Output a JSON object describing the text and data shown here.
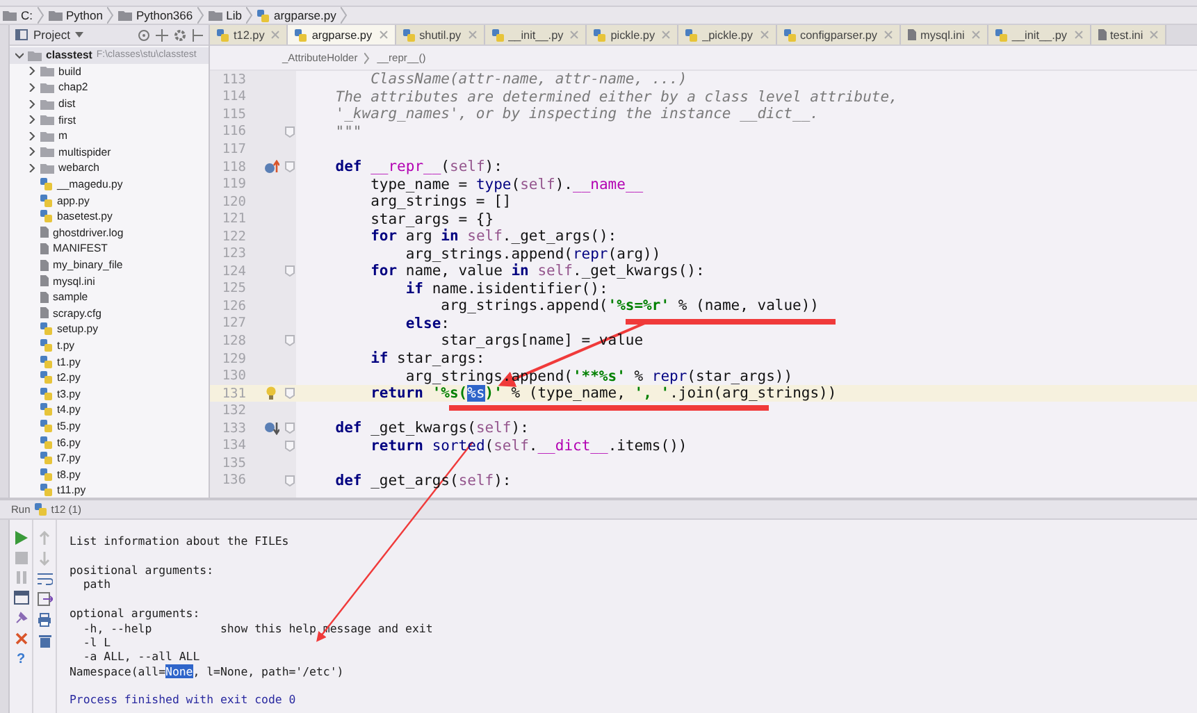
{
  "breadcrumbs": [
    {
      "label": "C:",
      "kind": "drive"
    },
    {
      "label": "Python",
      "kind": "folder"
    },
    {
      "label": "Python366",
      "kind": "folder"
    },
    {
      "label": "Lib",
      "kind": "folder"
    },
    {
      "label": "argparse.py",
      "kind": "python"
    }
  ],
  "project_panel": {
    "title": "Project",
    "tree": [
      {
        "label": "classtest",
        "path": "F:\\classes\\stu\\classtest",
        "kind": "folder",
        "expanded": true,
        "children": [
          {
            "label": "build",
            "kind": "folder",
            "expanded": false
          },
          {
            "label": "chap2",
            "kind": "folder",
            "expanded": false
          },
          {
            "label": "dist",
            "kind": "folder",
            "expanded": false
          },
          {
            "label": "first",
            "kind": "folder",
            "expanded": false
          },
          {
            "label": "m",
            "kind": "folder",
            "expanded": false
          },
          {
            "label": "multispider",
            "kind": "folder",
            "expanded": false
          },
          {
            "label": "webarch",
            "kind": "folder",
            "expanded": false
          },
          {
            "label": "__magedu.py",
            "kind": "python"
          },
          {
            "label": "app.py",
            "kind": "python"
          },
          {
            "label": "basetest.py",
            "kind": "python"
          },
          {
            "label": "ghostdriver.log",
            "kind": "file"
          },
          {
            "label": "MANIFEST",
            "kind": "file"
          },
          {
            "label": "my_binary_file",
            "kind": "file"
          },
          {
            "label": "mysql.ini",
            "kind": "file"
          },
          {
            "label": "sample",
            "kind": "file"
          },
          {
            "label": "scrapy.cfg",
            "kind": "file"
          },
          {
            "label": "setup.py",
            "kind": "python"
          },
          {
            "label": "t.py",
            "kind": "python"
          },
          {
            "label": "t1.py",
            "kind": "python"
          },
          {
            "label": "t2.py",
            "kind": "python"
          },
          {
            "label": "t3.py",
            "kind": "python"
          },
          {
            "label": "t4.py",
            "kind": "python"
          },
          {
            "label": "t5.py",
            "kind": "python"
          },
          {
            "label": "t6.py",
            "kind": "python"
          },
          {
            "label": "t7.py",
            "kind": "python"
          },
          {
            "label": "t8.py",
            "kind": "python"
          },
          {
            "label": "t11.py",
            "kind": "python"
          }
        ]
      }
    ]
  },
  "tabs": [
    {
      "label": "t12.py",
      "kind": "python",
      "selected": false
    },
    {
      "label": "argparse.py",
      "kind": "python",
      "selected": true
    },
    {
      "label": "shutil.py",
      "kind": "python",
      "selected": false
    },
    {
      "label": "__init__.py",
      "kind": "python",
      "selected": false
    },
    {
      "label": "pickle.py",
      "kind": "python",
      "selected": false
    },
    {
      "label": "_pickle.py",
      "kind": "python",
      "selected": false
    },
    {
      "label": "configparser.py",
      "kind": "python",
      "selected": false
    },
    {
      "label": "mysql.ini",
      "kind": "file",
      "selected": false
    },
    {
      "label": "__init__.py",
      "kind": "python",
      "selected": false
    },
    {
      "label": "test.ini",
      "kind": "file",
      "selected": false
    }
  ],
  "editor": {
    "breadcrumbs": [
      "_AttributeHolder",
      "__repr__()"
    ],
    "lines": [
      {
        "number": "113",
        "fold": false,
        "current": false,
        "tokens": [
          {
            "kind": "doc",
            "text": "        ClassName(attr-name, attr-name, ...)"
          }
        ]
      },
      {
        "number": "114",
        "fold": false,
        "current": false,
        "tokens": [
          {
            "kind": "doc",
            "text": "    The attributes are determined either by a class level attribute,"
          }
        ]
      },
      {
        "number": "115",
        "fold": false,
        "current": false,
        "tokens": [
          {
            "kind": "doc",
            "text": "    '_kwarg_names', or by inspecting the instance __dict__."
          }
        ]
      },
      {
        "number": "116",
        "fold": true,
        "current": false,
        "tokens": [
          {
            "kind": "doc",
            "text": "    \"\"\""
          }
        ]
      },
      {
        "number": "117",
        "fold": false,
        "current": false
      },
      {
        "number": "118",
        "fold": true,
        "current": false,
        "kind": "override",
        "tokens": [
          {
            "kind": "keyword",
            "text": "    def"
          },
          {
            "kind": "magic",
            "text": " __repr__"
          },
          {
            "kind": "plain",
            "text": "("
          },
          {
            "kind": "self",
            "text": "self"
          },
          {
            "kind": "plain",
            "text": "):"
          }
        ]
      },
      {
        "number": "119",
        "fold": false,
        "current": false,
        "tokens": [
          {
            "kind": "plain",
            "text": "        type_name = "
          },
          {
            "kind": "builtin",
            "text": "type"
          },
          {
            "kind": "plain",
            "text": "("
          },
          {
            "kind": "self",
            "text": "self"
          },
          {
            "kind": "plain",
            "text": ")."
          },
          {
            "kind": "magic",
            "text": "__name__"
          }
        ]
      },
      {
        "number": "120",
        "fold": false,
        "current": false,
        "tokens": [
          {
            "kind": "plain",
            "text": "        arg_strings = []"
          }
        ]
      },
      {
        "number": "121",
        "fold": false,
        "current": false,
        "tokens": [
          {
            "kind": "plain",
            "text": "        star_args = {}"
          }
        ]
      },
      {
        "number": "122",
        "fold": false,
        "current": false,
        "tokens": [
          {
            "kind": "keyword",
            "text": "        for"
          },
          {
            "kind": "plain",
            "text": " arg "
          },
          {
            "kind": "keyword",
            "text": "in"
          },
          {
            "kind": "self",
            "text": " self"
          },
          {
            "kind": "plain",
            "text": "._get_args():"
          }
        ]
      },
      {
        "number": "123",
        "fold": false,
        "current": false,
        "tokens": [
          {
            "kind": "plain",
            "text": "            arg_strings.append("
          },
          {
            "kind": "builtin",
            "text": "repr"
          },
          {
            "kind": "plain",
            "text": "(arg))"
          }
        ]
      },
      {
        "number": "124",
        "fold": true,
        "current": false,
        "tokens": [
          {
            "kind": "keyword",
            "text": "        for"
          },
          {
            "kind": "plain",
            "text": " name, value "
          },
          {
            "kind": "keyword",
            "text": "in"
          },
          {
            "kind": "self",
            "text": " self"
          },
          {
            "kind": "plain",
            "text": "._get_kwargs():"
          }
        ]
      },
      {
        "number": "125",
        "fold": false,
        "current": false,
        "tokens": [
          {
            "kind": "keyword",
            "text": "            if"
          },
          {
            "kind": "plain",
            "text": " name.isidentifier():"
          }
        ]
      },
      {
        "number": "126",
        "fold": false,
        "current": false,
        "tokens": [
          {
            "kind": "plain",
            "text": "                arg_strings.append("
          },
          {
            "kind": "string",
            "text": "'%s=%r'"
          },
          {
            "kind": "plain",
            "text": " % (name, value))"
          }
        ]
      },
      {
        "number": "127",
        "fold": false,
        "current": false,
        "tokens": [
          {
            "kind": "keyword",
            "text": "            else"
          },
          {
            "kind": "plain",
            "text": ":"
          }
        ]
      },
      {
        "number": "128",
        "fold": true,
        "current": false,
        "tokens": [
          {
            "kind": "plain",
            "text": "                star_args[name] = value"
          }
        ]
      },
      {
        "number": "129",
        "fold": false,
        "current": false,
        "tokens": [
          {
            "kind": "keyword",
            "text": "        if"
          },
          {
            "kind": "plain",
            "text": " star_args:"
          }
        ]
      },
      {
        "number": "130",
        "fold": false,
        "current": false,
        "tokens": [
          {
            "kind": "plain",
            "text": "            arg_strings.append("
          },
          {
            "kind": "string",
            "text": "'**%s'"
          },
          {
            "kind": "plain",
            "text": " % "
          },
          {
            "kind": "builtin",
            "text": "repr"
          },
          {
            "kind": "plain",
            "text": "(star_args))"
          }
        ]
      },
      {
        "number": "131",
        "fold": true,
        "current": true,
        "kind": "bulb",
        "tokens": [
          {
            "kind": "keyword",
            "text": "        return"
          },
          {
            "kind": "string",
            "text": " '%s("
          },
          {
            "kind": "selected",
            "text": "%s"
          },
          {
            "kind": "string",
            "text": ")'"
          },
          {
            "kind": "plain",
            "text": " % (type_name, "
          },
          {
            "kind": "string",
            "text": "', '"
          },
          {
            "kind": "plain",
            "text": ".join(arg_strings))"
          }
        ]
      },
      {
        "number": "132",
        "fold": false,
        "current": false
      },
      {
        "number": "133",
        "fold": true,
        "current": false,
        "kind": "implemented",
        "tokens": [
          {
            "kind": "keyword",
            "text": "    def"
          },
          {
            "kind": "plain",
            "text": " _get_kwargs("
          },
          {
            "kind": "self",
            "text": "self"
          },
          {
            "kind": "plain",
            "text": "):"
          }
        ]
      },
      {
        "number": "134",
        "fold": true,
        "current": false,
        "tokens": [
          {
            "kind": "keyword",
            "text": "        return"
          },
          {
            "kind": "builtin",
            "text": " sorted"
          },
          {
            "kind": "plain",
            "text": "("
          },
          {
            "kind": "self",
            "text": "self"
          },
          {
            "kind": "plain",
            "text": "."
          },
          {
            "kind": "magic",
            "text": "__dict__"
          },
          {
            "kind": "plain",
            "text": ".items())"
          }
        ]
      },
      {
        "number": "135",
        "fold": false,
        "current": false
      },
      {
        "number": "136",
        "fold": true,
        "current": false,
        "tokens": [
          {
            "kind": "keyword",
            "text": "    def"
          },
          {
            "kind": "plain",
            "text": " _get_args("
          },
          {
            "kind": "self",
            "text": "self"
          },
          {
            "kind": "plain",
            "text": "):"
          }
        ]
      }
    ]
  },
  "run_panel": {
    "title": "Run",
    "config": "t12 (1)",
    "help": "?",
    "output": [
      {
        "kind": "stdout",
        "segments": [
          {
            "text": "List information about the FILEs",
            "selected": false
          }
        ]
      },
      {
        "kind": "stdout"
      },
      {
        "kind": "stdout",
        "segments": [
          {
            "text": "positional arguments:",
            "selected": false
          }
        ]
      },
      {
        "kind": "stdout",
        "segments": [
          {
            "text": "  path",
            "selected": false
          }
        ]
      },
      {
        "kind": "stdout"
      },
      {
        "kind": "stdout",
        "segments": [
          {
            "text": "optional arguments:",
            "selected": false
          }
        ]
      },
      {
        "kind": "stdout",
        "segments": [
          {
            "text": "  -h, --help          show this help message and exit",
            "selected": false
          }
        ]
      },
      {
        "kind": "stdout",
        "segments": [
          {
            "text": "  -l L",
            "selected": false
          }
        ]
      },
      {
        "kind": "stdout",
        "segments": [
          {
            "text": "  -a ALL, --all ALL",
            "selected": false
          }
        ]
      },
      {
        "kind": "stdout",
        "segments": [
          {
            "text": "Namespace(all=",
            "selected": false
          },
          {
            "text": "None",
            "selected": true
          },
          {
            "text": ", l=None, path='/etc')",
            "selected": false
          }
        ]
      },
      {
        "kind": "stdout"
      },
      {
        "kind": "system",
        "segments": [
          {
            "text": "Process finished with exit code 0",
            "selected": false
          }
        ]
      }
    ]
  }
}
